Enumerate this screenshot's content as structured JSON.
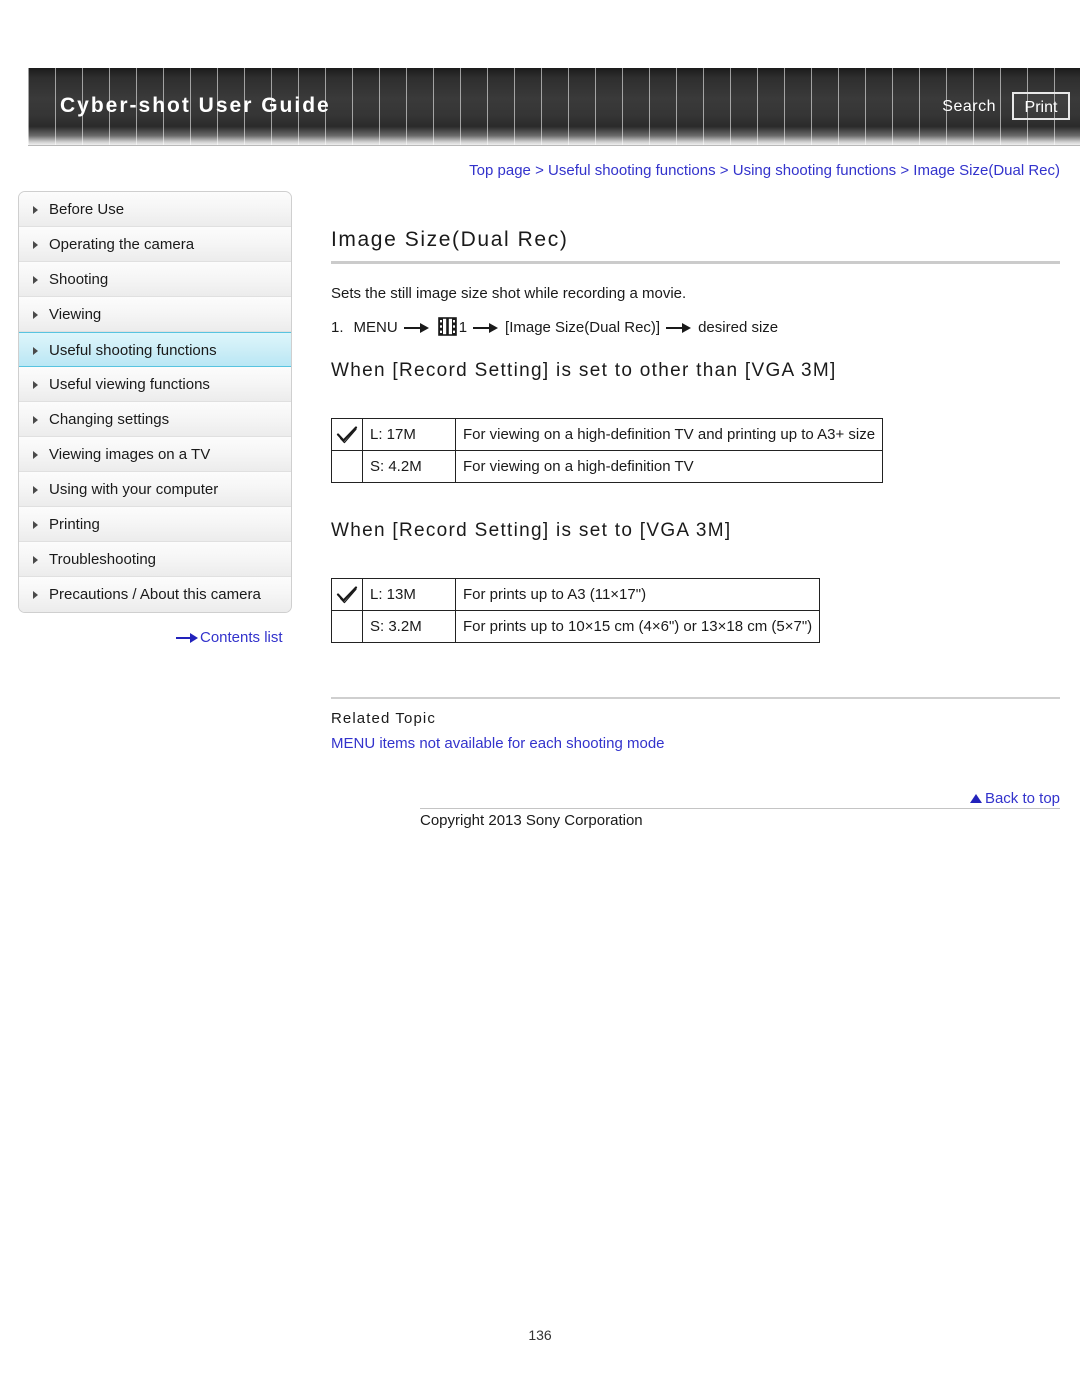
{
  "header": {
    "title": "Cyber-shot User Guide",
    "search_label": "Search",
    "print_label": "Print"
  },
  "breadcrumb": {
    "text": "Top page > Useful shooting functions > Using shooting functions > Image Size(Dual Rec)",
    "items": [
      "Top page",
      "Useful shooting functions",
      "Using shooting functions",
      "Image Size(Dual Rec)"
    ],
    "separator": ">"
  },
  "sidebar": {
    "items": [
      {
        "label": "Before Use",
        "active": false
      },
      {
        "label": "Operating the camera",
        "active": false
      },
      {
        "label": "Shooting",
        "active": false
      },
      {
        "label": "Viewing",
        "active": false
      },
      {
        "label": "Useful shooting functions",
        "active": true
      },
      {
        "label": "Useful viewing functions",
        "active": false
      },
      {
        "label": "Changing settings",
        "active": false
      },
      {
        "label": "Viewing images on a TV",
        "active": false
      },
      {
        "label": "Using with your computer",
        "active": false
      },
      {
        "label": "Printing",
        "active": false
      },
      {
        "label": "Troubleshooting",
        "active": false
      },
      {
        "label": "Precautions / About this camera",
        "active": false
      }
    ],
    "contents_link": "Contents list",
    "contents_icon": "right-arrow-icon",
    "bullet_icon": "triangle-right-icon"
  },
  "main": {
    "page_title": "Image Size(Dual Rec)",
    "intro": "Sets the still image size shot while recording a movie.",
    "step": {
      "number": "1.",
      "menu_label": "MENU",
      "icon": "film-strip-icon",
      "icon_number": "1",
      "item_label": "[Image Size(Dual Rec)]",
      "result_label": "desired size",
      "arrow_icon": "right-arrow-icon"
    },
    "sections": [
      {
        "heading": "When [Record Setting] is set to other than [VGA 3M]",
        "rows": [
          {
            "checked": true,
            "check_icon": "check-mark-icon",
            "size": "L: 17M",
            "description": "For viewing on a high-definition TV and printing up to A3+ size"
          },
          {
            "checked": false,
            "check_icon": "",
            "size": "S: 4.2M",
            "description": "For viewing on a high-definition TV"
          }
        ]
      },
      {
        "heading": "When [Record Setting] is set to [VGA 3M]",
        "rows": [
          {
            "checked": true,
            "check_icon": "check-mark-icon",
            "size": "L: 13M",
            "description": "For prints up to A3 (11×17\")"
          },
          {
            "checked": false,
            "check_icon": "",
            "size": "S: 3.2M",
            "description": "For prints up to 10×15 cm (4×6\") or 13×18 cm (5×7\")"
          }
        ]
      }
    ],
    "related": {
      "heading": "Related Topic",
      "link": "MENU items not available for each shooting mode"
    }
  },
  "footer": {
    "back_to_top": "Back to top",
    "back_to_top_icon": "triangle-up-icon",
    "copyright": "Copyright 2013 Sony Corporation",
    "page_number": "136"
  },
  "colors": {
    "link": "#3333cc",
    "active_sidebar": "#b9e7f5",
    "header_dark": "#2e2e2e"
  }
}
